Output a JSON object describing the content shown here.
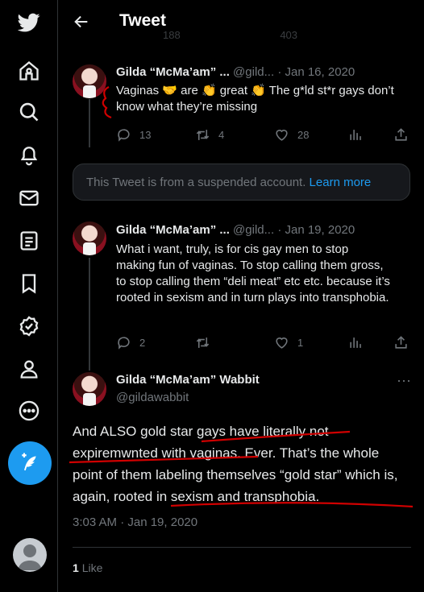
{
  "header": {
    "title": "Tweet",
    "faded_counts": [
      "188",
      "403"
    ]
  },
  "tweets": [
    {
      "name": "Gilda “McMa’am” ...",
      "handle": "@gild...",
      "date": "· Jan 16, 2020",
      "text": "Vaginas 🤝 are 👏 great 👏 The g*ld st*r gays don’t know what they’re missing",
      "replies": "13",
      "retweets": "4",
      "likes": "28"
    },
    {
      "name": "Gilda “McMa’am” ...",
      "handle": "@gild...",
      "date": "· Jan 19, 2020",
      "text": "What i want, truly, is for cis gay men to stop making fun of vaginas. To stop calling them gross, to stop calling them “deli meat” etc etc. because it’s rooted in sexism and in turn plays into transphobia.",
      "replies": "2",
      "retweets": "",
      "likes": "1"
    }
  ],
  "suspended": {
    "text": "This Tweet is from a suspended account.",
    "link": "Learn more"
  },
  "main_tweet": {
    "name": "Gilda “McMa’am” Wabbit",
    "handle": "@gildawabbit",
    "text": "And ALSO gold star gays have literally not expiremwnted with vaginas. Ever. That’s the whole point of them labeling themselves “gold star” which is, again, rooted in sexism and transphobia.",
    "time": "3:03 AM · Jan 19, 2020",
    "like_count": "1",
    "like_label": "Like"
  },
  "colors": {
    "accent": "#1d9bf0",
    "annotation": "#d00000",
    "background": "#000000"
  }
}
